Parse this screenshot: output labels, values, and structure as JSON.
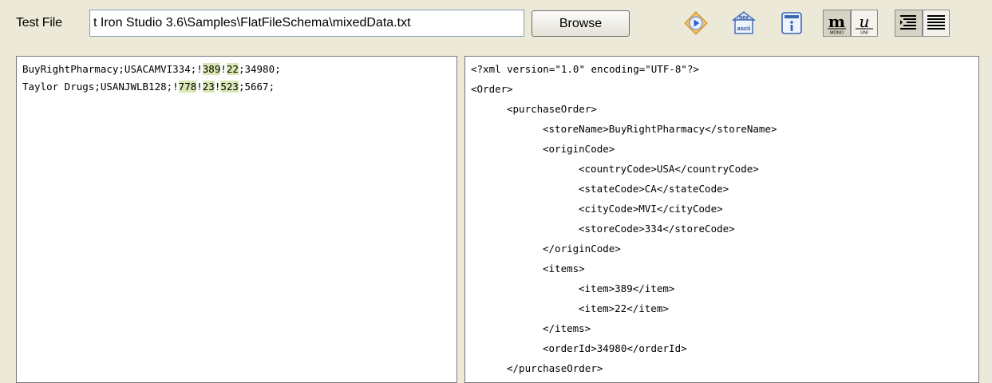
{
  "toolbar": {
    "test_file_label": "Test File",
    "file_path": "t Iron Studio 3.6\\Samples\\FlatFileSchema\\mixedData.txt",
    "browse_label": "Browse",
    "icons": [
      "run-test-icon",
      "hex-ascii-icon",
      "info-icon",
      "mono-font-icon",
      "unicode-font-icon",
      "align-indent-icon",
      "align-justify-icon"
    ]
  },
  "input_panel": {
    "lines": [
      {
        "segments": [
          {
            "text": "BuyRightPharmacy;USACAMVI334;!",
            "hl": false
          },
          {
            "text": "389",
            "hl": true
          },
          {
            "text": "!",
            "hl": false
          },
          {
            "text": "22",
            "hl": true
          },
          {
            "text": ";34980;",
            "hl": false
          }
        ]
      },
      {
        "segments": [
          {
            "text": "Taylor Drugs;USANJWLB128;!",
            "hl": false
          },
          {
            "text": "778",
            "hl": true
          },
          {
            "text": "!",
            "hl": false
          },
          {
            "text": "23",
            "hl": true
          },
          {
            "text": "!",
            "hl": false
          },
          {
            "text": "523",
            "hl": true
          },
          {
            "text": ";5667;",
            "hl": false
          }
        ]
      }
    ]
  },
  "output_panel": {
    "lines": [
      {
        "indent": 0,
        "text": "<?xml version=\"1.0\" encoding=\"UTF-8\"?>"
      },
      {
        "indent": 0,
        "text": "<Order>"
      },
      {
        "indent": 1,
        "text": "<purchaseOrder>"
      },
      {
        "indent": 2,
        "text": "<storeName>BuyRightPharmacy</storeName>"
      },
      {
        "indent": 2,
        "text": "<originCode>"
      },
      {
        "indent": 3,
        "text": "<countryCode>USA</countryCode>"
      },
      {
        "indent": 3,
        "text": "<stateCode>CA</stateCode>"
      },
      {
        "indent": 3,
        "text": "<cityCode>MVI</cityCode>"
      },
      {
        "indent": 3,
        "text": "<storeCode>334</storeCode>"
      },
      {
        "indent": 2,
        "text": "</originCode>"
      },
      {
        "indent": 2,
        "text": "<items>"
      },
      {
        "indent": 3,
        "text": "<item>389</item>"
      },
      {
        "indent": 3,
        "text": "<item>22</item>"
      },
      {
        "indent": 2,
        "text": "</items>"
      },
      {
        "indent": 2,
        "text": "<orderId>34980</orderId>"
      },
      {
        "indent": 1,
        "text": "</purchaseOrder>"
      }
    ]
  }
}
